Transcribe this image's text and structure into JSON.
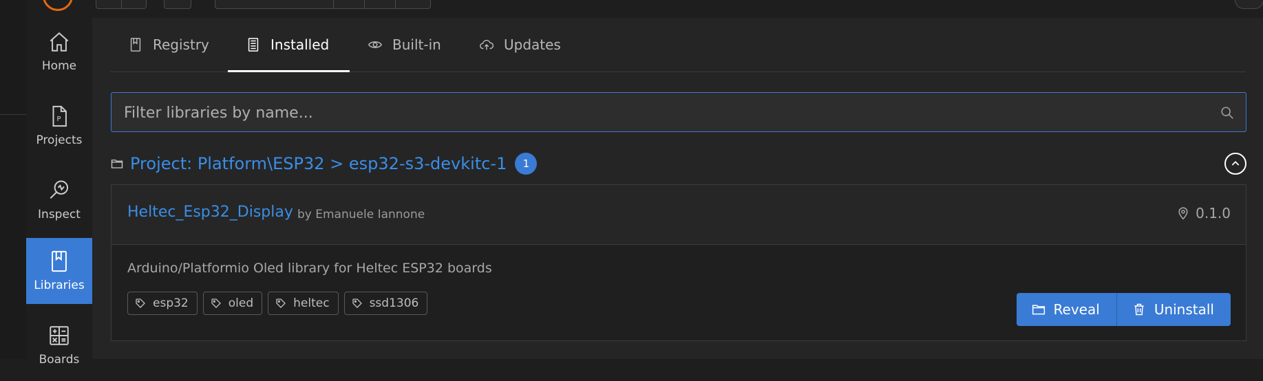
{
  "nav": {
    "items": [
      {
        "label": "Home",
        "icon": "home-icon"
      },
      {
        "label": "Projects",
        "icon": "project-file-icon"
      },
      {
        "label": "Inspect",
        "icon": "inspect-icon"
      },
      {
        "label": "Libraries",
        "icon": "book-icon",
        "active": true
      },
      {
        "label": "Boards",
        "icon": "calculator-icon"
      }
    ]
  },
  "tabs": [
    {
      "label": "Registry",
      "icon": "bookmark-icon"
    },
    {
      "label": "Installed",
      "icon": "archive-icon",
      "active": true
    },
    {
      "label": "Built-in",
      "icon": "eye-icon"
    },
    {
      "label": "Updates",
      "icon": "cloud-upload-icon"
    }
  ],
  "search": {
    "placeholder": "Filter libraries by name..."
  },
  "group": {
    "title": "Project: Platform\\ESP32 > esp32-s3-devkitc-1",
    "count": "1"
  },
  "library": {
    "name": "Heltec_Esp32_Display",
    "author": "by Emanuele Iannone",
    "version": "0.1.0",
    "description": "Arduino/Platformio Oled library for Heltec ESP32 boards",
    "tags": [
      "esp32",
      "oled",
      "heltec",
      "ssd1306"
    ],
    "actions": {
      "reveal": "Reveal",
      "uninstall": "Uninstall"
    }
  },
  "colors": {
    "accent": "#3a7bd5",
    "link": "#3a8ee6",
    "background": "#252526"
  }
}
